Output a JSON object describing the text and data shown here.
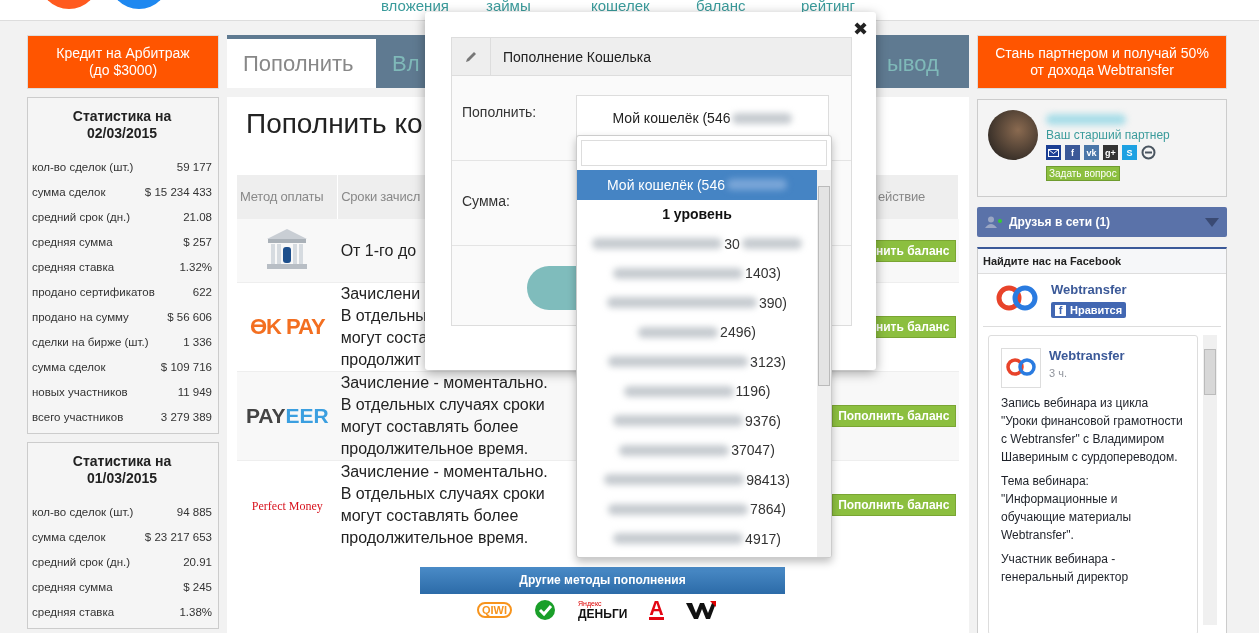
{
  "header": {
    "nav": [
      "вложения",
      "займы",
      "кошелек",
      "баланс",
      "рейтинг"
    ]
  },
  "left": {
    "banner": "Кредит на Арбитраж\n(до $3000)",
    "stats": [
      {
        "title": "Статистика на\n02/03/2015",
        "rows": [
          {
            "label": "кол-во сделок (шт.)",
            "value": "59 177"
          },
          {
            "label": "сумма сделок",
            "value": "$ 15 234 433"
          },
          {
            "label": "средний срок (дн.)",
            "value": "21.08"
          },
          {
            "label": "средняя сумма",
            "value": "$ 257"
          },
          {
            "label": "средняя ставка",
            "value": "1.32%"
          },
          {
            "label": "продано сертификатов",
            "value": "622"
          },
          {
            "label": "продано на сумму",
            "value": "$ 56 606"
          },
          {
            "label": "сделки на бирже (шт.)",
            "value": "1 336"
          },
          {
            "label": "сумма сделок",
            "value": "$ 109 716"
          },
          {
            "label": "новых участников",
            "value": "11 949"
          },
          {
            "label": "всего участников",
            "value": "3 279 389"
          }
        ]
      },
      {
        "title": "Статистика на\n01/03/2015",
        "rows": [
          {
            "label": "кол-во сделок (шт.)",
            "value": "94 885"
          },
          {
            "label": "сумма сделок",
            "value": "$ 23 217 653"
          },
          {
            "label": "средний срок (дн.)",
            "value": "20.91"
          },
          {
            "label": "средняя сумма",
            "value": "$ 245"
          },
          {
            "label": "средняя ставка",
            "value": "1.38%"
          }
        ]
      }
    ]
  },
  "center": {
    "tabs": [
      {
        "label": "Пополнить",
        "selected": true
      },
      {
        "label": "Вл",
        "selected": false
      },
      {
        "label": "ывод",
        "selected": false
      }
    ],
    "heading": "Пополнить ко",
    "columns": [
      "Метод оплаты",
      "Сроки зачисл",
      "ействие"
    ],
    "rows": [
      {
        "logo": {
          "kind": "bank"
        },
        "terms": "От 1-го до",
        "button": "нить баланс"
      },
      {
        "logo": {
          "kind": "okpay",
          "text": "ӨK PAY"
        },
        "terms": "Зачислени\nВ отдельны\nмогут соста\nпродолжит",
        "button": "нить баланс"
      },
      {
        "logo": {
          "kind": "payeer",
          "text": "PAY",
          "accent": "EER"
        },
        "terms": "Зачисление - моментально.\nВ отдельных случаях сроки\nмогут составлять более\nпродолжительное время.",
        "button": "Пополнить баланс"
      },
      {
        "logo": {
          "kind": "perfect",
          "text": "Perfect Money"
        },
        "terms": "Зачисление - моментально.\nВ отдельных случаях сроки\nмогут составлять более\nпродолжительное время.",
        "button": "Пополнить баланс"
      }
    ],
    "other_button": "Другие методы пополнения",
    "methods": [
      {
        "kind": "qiwi",
        "text": "QIWI"
      },
      {
        "kind": "sber"
      },
      {
        "kind": "yandex",
        "text": "Яндекс",
        "accent": "ДЕНЬГИ"
      },
      {
        "kind": "alfa",
        "text": "А"
      },
      {
        "kind": "webmoney"
      }
    ]
  },
  "right": {
    "banner": "Стань партнером и получай 50%\nот дохода Webtransfer",
    "partner": {
      "role": "Ваш старший партнер",
      "ask_button": "Задать вопрос",
      "contacts": [
        {
          "kind": "mail",
          "color": "#1c3f94"
        },
        {
          "kind": "glyph",
          "text": "f",
          "color": "#3b5998"
        },
        {
          "kind": "glyph",
          "text": "vk",
          "color": "#4a76a8"
        },
        {
          "kind": "glyph",
          "text": "g+",
          "color": "#333333"
        },
        {
          "kind": "glyph",
          "text": "S",
          "color": "#1da1e2"
        },
        {
          "kind": "chat",
          "color": "#4a5560"
        }
      ]
    },
    "friends": "Друзья в сети (1)",
    "facebook": {
      "header": "Найдите нас на Facebook",
      "page": "Webtransfer",
      "like_icon": "f",
      "like": "Нравится",
      "post": {
        "author": "Webtransfer",
        "time": "3 ч.",
        "paragraphs": [
          "Запись вебинара из цикла \"Уроки финансовой грамотности с Webtransfer\" с Владимиром Шавериным с сурдопереводом.",
          "Тема вебинара: \"Информационные и обучающие материалы Webtransfer\".",
          "Участник вебинара - генеральный директор"
        ]
      }
    }
  },
  "modal": {
    "close": "✖",
    "title": "Пополнение Кошелька",
    "fields": [
      {
        "label": "Пополнить:"
      },
      {
        "label": "Сумма:"
      }
    ],
    "select_value": "Мой кошелёк (546",
    "dropdown": [
      {
        "kind": "option",
        "text": "Мой кошелёк (546",
        "selected": true
      },
      {
        "kind": "group",
        "text": "1 уровень"
      },
      {
        "kind": "option",
        "text": "30",
        "selected": false
      },
      {
        "kind": "option",
        "text": "1403)",
        "selected": false
      },
      {
        "kind": "option",
        "text": "390)",
        "selected": false
      },
      {
        "kind": "option",
        "text": "2496)",
        "selected": false
      },
      {
        "kind": "option",
        "text": "3123)",
        "selected": false
      },
      {
        "kind": "option",
        "text": "1196)",
        "selected": false
      },
      {
        "kind": "option",
        "text": "9376)",
        "selected": false
      },
      {
        "kind": "option",
        "text": "37047)",
        "selected": false
      },
      {
        "kind": "option",
        "text": "98413)",
        "selected": false
      },
      {
        "kind": "option",
        "text": "7864)",
        "selected": false
      },
      {
        "kind": "option",
        "text": "4917)",
        "selected": false
      }
    ]
  }
}
